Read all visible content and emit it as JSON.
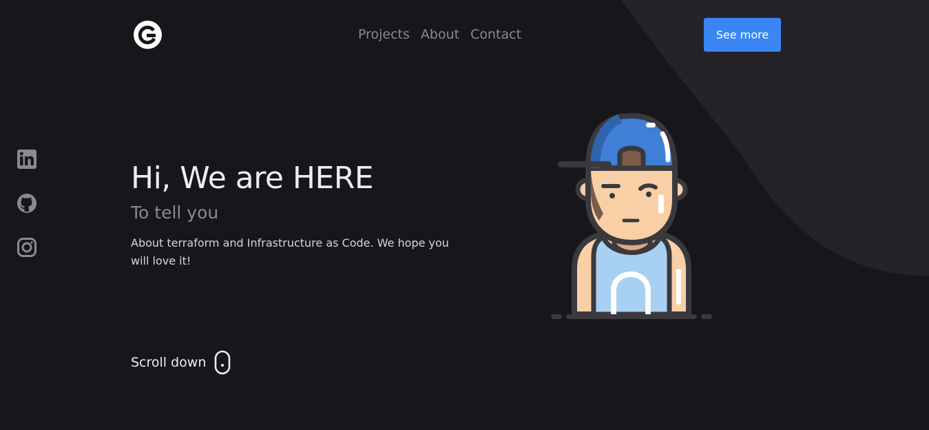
{
  "header": {
    "logo_icon": "g-logo-icon",
    "nav": [
      {
        "label": "Projects"
      },
      {
        "label": "About"
      },
      {
        "label": "Contact"
      }
    ],
    "cta_label": "See more"
  },
  "social": [
    {
      "icon": "linkedin-icon"
    },
    {
      "icon": "github-icon"
    },
    {
      "icon": "instagram-icon"
    }
  ],
  "hero": {
    "title": "Hi, We are HERE",
    "subtitle": "To tell you",
    "description": "About terraform and Infrastructure as Code. We hope you will love it!"
  },
  "scroll": {
    "label": "Scroll down",
    "icon": "mouse-icon"
  },
  "illustration": {
    "icon": "avatar-illustration"
  },
  "colors": {
    "background": "#17161b",
    "shape": "#242329",
    "accent": "#3a86f4",
    "muted_text": "#8b8a90",
    "text": "#eeeef0"
  }
}
